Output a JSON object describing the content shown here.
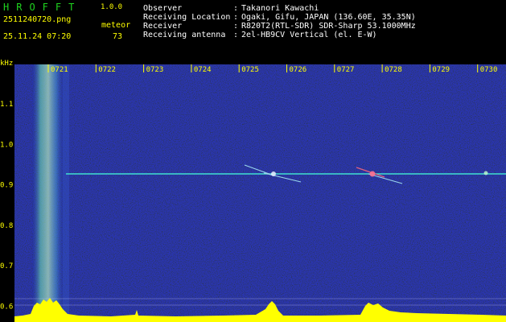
{
  "header": {
    "brand": "HROFFT",
    "version": "1.0.0",
    "filename": "2511240720.png",
    "meteor_label": "meteor",
    "datetime": "25.11.24 07:20",
    "meteor_count": "73"
  },
  "info": [
    {
      "label": "Observer",
      "value": "Takanori Kawachi"
    },
    {
      "label": "Receiving Location",
      "value": "Ogaki, Gifu, JAPAN (136.60E, 35.35N)"
    },
    {
      "label": "Receiver",
      "value": "R820T2(RTL-SDR) SDR-Sharp 53.1000MHz"
    },
    {
      "label": "Receiving antenna",
      "value": "2el-HB9CV Vertical (el. E-W)"
    }
  ],
  "axis": {
    "freq_unit": "kHz",
    "time_ticks": [
      "0721",
      "0722",
      "0723",
      "0724",
      "0725",
      "0726",
      "0727",
      "0728",
      "0729",
      "0730"
    ],
    "freq_ticks": [
      "1.1",
      "1.0",
      "0.9",
      "0.8",
      "0.7",
      "0.6"
    ]
  },
  "colors": {
    "background": "#000000",
    "spectrogram": "#1a1f9a",
    "tick": "#ffff00",
    "carrier": "#40e0d0",
    "brand": "#1fd41f"
  }
}
